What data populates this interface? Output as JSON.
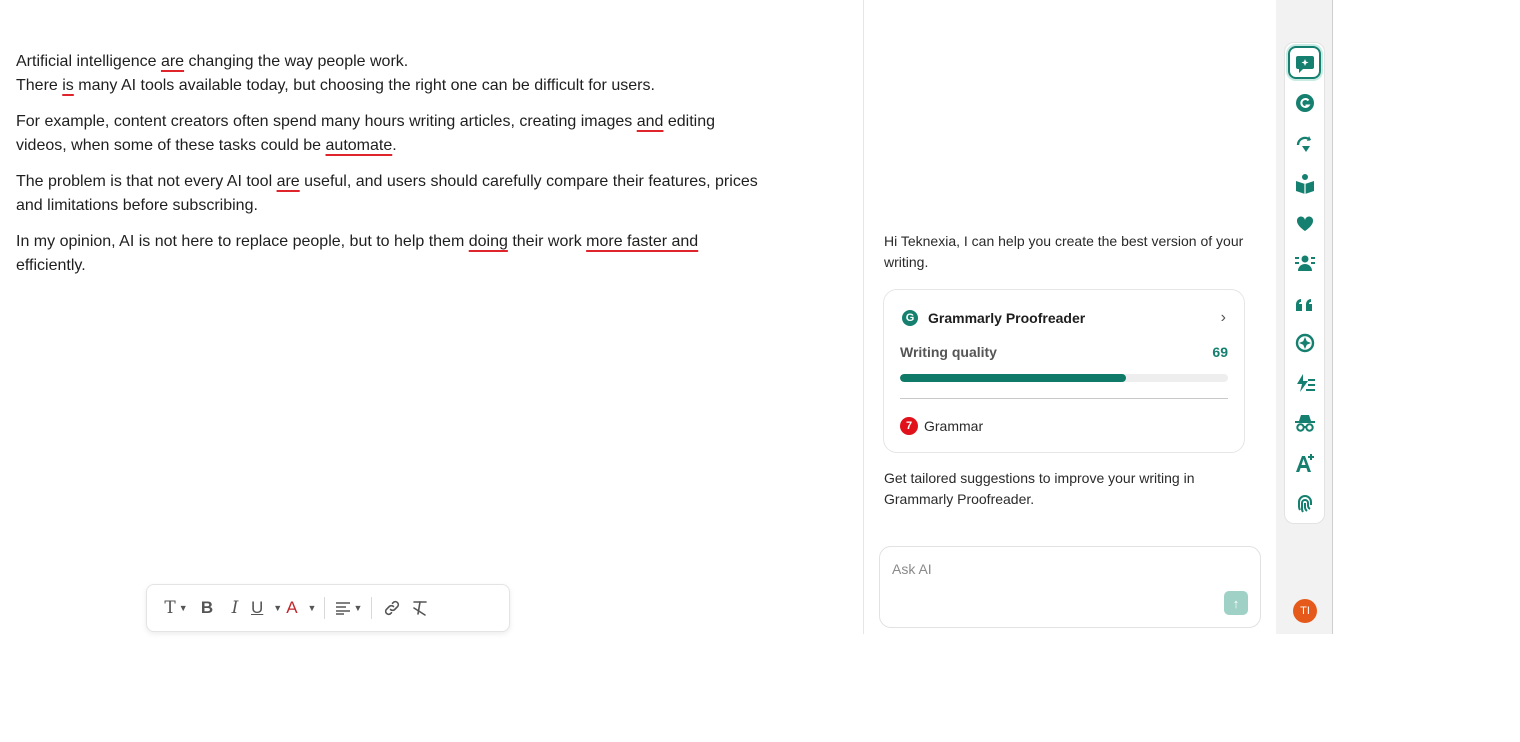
{
  "document": {
    "paragraphs": [
      {
        "lines": [
          [
            {
              "t": "Artificial intelligence "
            },
            {
              "t": "are",
              "err": true
            },
            {
              "t": " changing the way people work."
            }
          ],
          [
            {
              "t": "There "
            },
            {
              "t": "is",
              "err": true
            },
            {
              "t": " many AI tools available today, but choosing the right one can be difficult for users."
            }
          ]
        ]
      },
      {
        "lines": [
          [
            {
              "t": "For example, content creators often spend many hours writing articles, creating images "
            },
            {
              "t": "and",
              "err": true
            },
            {
              "t": " editing"
            }
          ],
          [
            {
              "t": "videos, when some of these tasks could be "
            },
            {
              "t": "automate",
              "err": true
            },
            {
              "t": "."
            }
          ]
        ]
      },
      {
        "lines": [
          [
            {
              "t": "The problem is that not every AI tool "
            },
            {
              "t": "are",
              "err": true
            },
            {
              "t": " useful, and users should carefully compare their features, prices"
            }
          ],
          [
            {
              "t": "and limitations before subscribing."
            }
          ]
        ]
      },
      {
        "lines": [
          [
            {
              "t": "In my opinion, AI is not here to replace people, but to help them "
            },
            {
              "t": "doing",
              "err": true
            },
            {
              "t": " their work "
            },
            {
              "t": "more faster and",
              "err": true
            }
          ],
          [
            {
              "t": "efficiently."
            }
          ]
        ]
      }
    ]
  },
  "toolbar": {
    "text_style_icon": "T",
    "bold": "B",
    "italic": "I",
    "underline": "U",
    "font_color": "A",
    "caret": "⌄"
  },
  "assistant": {
    "greeting": "Hi Teknexia, I can help you create the best version of your writing.",
    "card": {
      "logo_letter": "G",
      "title": "Grammarly Proofreader",
      "quality_label": "Writing quality",
      "quality_value": "69",
      "quality_fraction": 0.69,
      "grammar_count": "7",
      "grammar_label": "Grammar"
    },
    "tailored": "Get tailored suggestions to improve your writing in Grammarly Proofreader.",
    "ask_placeholder": "Ask AI",
    "send_icon": "↑"
  },
  "rail": {
    "items": [
      {
        "name": "chat-sparkle-icon",
        "active": true
      },
      {
        "name": "grammarly-logo-icon"
      },
      {
        "name": "paraphrase-icon"
      },
      {
        "name": "reader-book-icon"
      },
      {
        "name": "heart-hands-icon"
      },
      {
        "name": "audience-icon"
      },
      {
        "name": "quote-icon"
      },
      {
        "name": "ai-detector-icon"
      },
      {
        "name": "fast-list-icon"
      },
      {
        "name": "incognito-icon"
      },
      {
        "name": "font-plus-icon"
      },
      {
        "name": "fingerprint-icon"
      }
    ],
    "avatar_initials": "TI"
  },
  "colors": {
    "brand": "#15806f",
    "error": "#e0242b",
    "badge": "#e1111c",
    "avatar": "#e55a1b"
  }
}
